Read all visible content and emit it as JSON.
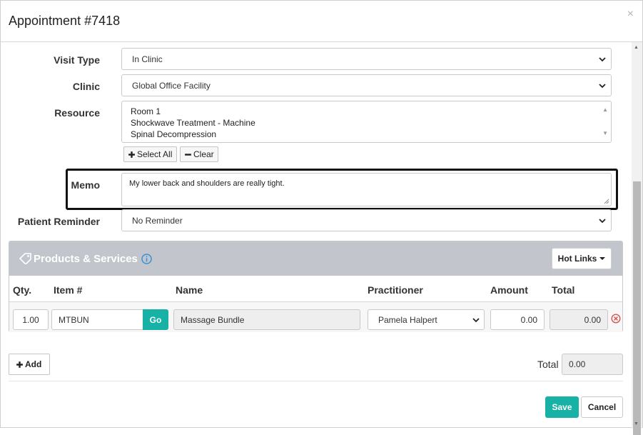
{
  "modal": {
    "title": "Appointment #7418",
    "close_glyph": "×"
  },
  "form": {
    "visit_type": {
      "label": "Visit Type",
      "value": "In Clinic"
    },
    "clinic": {
      "label": "Clinic",
      "value": "Global Office Facility"
    },
    "resource": {
      "label": "Resource",
      "options": [
        "Room 1",
        "Shockwave Treatment - Machine",
        "Spinal Decompression"
      ],
      "select_all_label": "Select All",
      "clear_label": "Clear"
    },
    "memo": {
      "label": "Memo",
      "value": "My lower back and shoulders are really tight."
    },
    "patient_reminder": {
      "label": "Patient Reminder",
      "value": "No Reminder"
    }
  },
  "products_services": {
    "title": "Products & Services",
    "hot_links_label": "Hot Links",
    "columns": [
      "Qty.",
      "Item #",
      "Name",
      "Practitioner",
      "Amount",
      "Total"
    ],
    "rows": [
      {
        "qty": "1.00",
        "item": "MTBUN",
        "go_label": "Go",
        "name": "Massage Bundle",
        "practitioner": "Pamela Halpert",
        "amount": "0.00",
        "total": "0.00"
      }
    ]
  },
  "footer": {
    "add_label": "Add",
    "total_label": "Total",
    "total_value": "0.00",
    "save_label": "Save",
    "cancel_label": "Cancel"
  },
  "colors": {
    "accent": "#17b1a6",
    "panel_header": "#c2c6cc",
    "remove_icon": "#d9534f",
    "info_icon": "#3a8fd6",
    "memo_highlight": "#111111"
  }
}
